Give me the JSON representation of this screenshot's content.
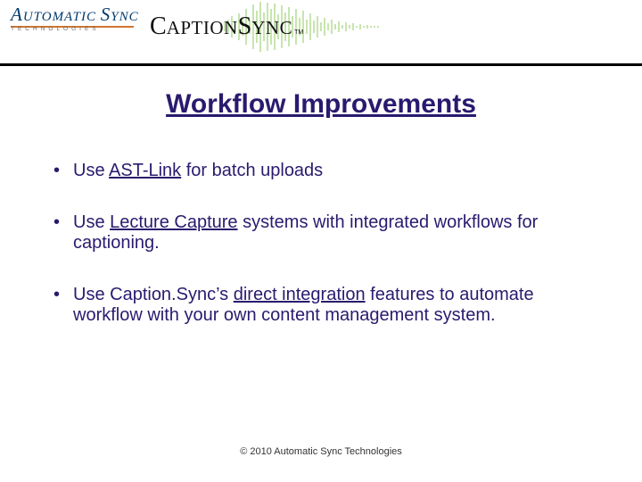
{
  "header": {
    "logo_ast_line1_a": "A",
    "logo_ast_line1_b": "UTOMATIC ",
    "logo_ast_line1_c": "S",
    "logo_ast_line1_d": "YNC",
    "logo_ast_line2": "TECHNOLOGIES",
    "logo_cs_c": "C",
    "logo_cs_aption": "APTION",
    "logo_cs_s": "S",
    "logo_cs_ync": "YNC",
    "logo_cs_tm": "TM"
  },
  "title": "Workflow Improvements",
  "bullets": {
    "b1_pre": "Use ",
    "b1_link": "AST-Link",
    "b1_post": " for batch uploads",
    "b2_pre": "Use ",
    "b2_link": "Lecture Capture",
    "b2_post": " systems with integrated workflows for captioning.",
    "b3_pre": "Use Caption.Sync’s ",
    "b3_link": "direct integration",
    "b3_post": " features to automate workflow with your own content management system."
  },
  "footer": "© 2010 Automatic Sync Technologies"
}
